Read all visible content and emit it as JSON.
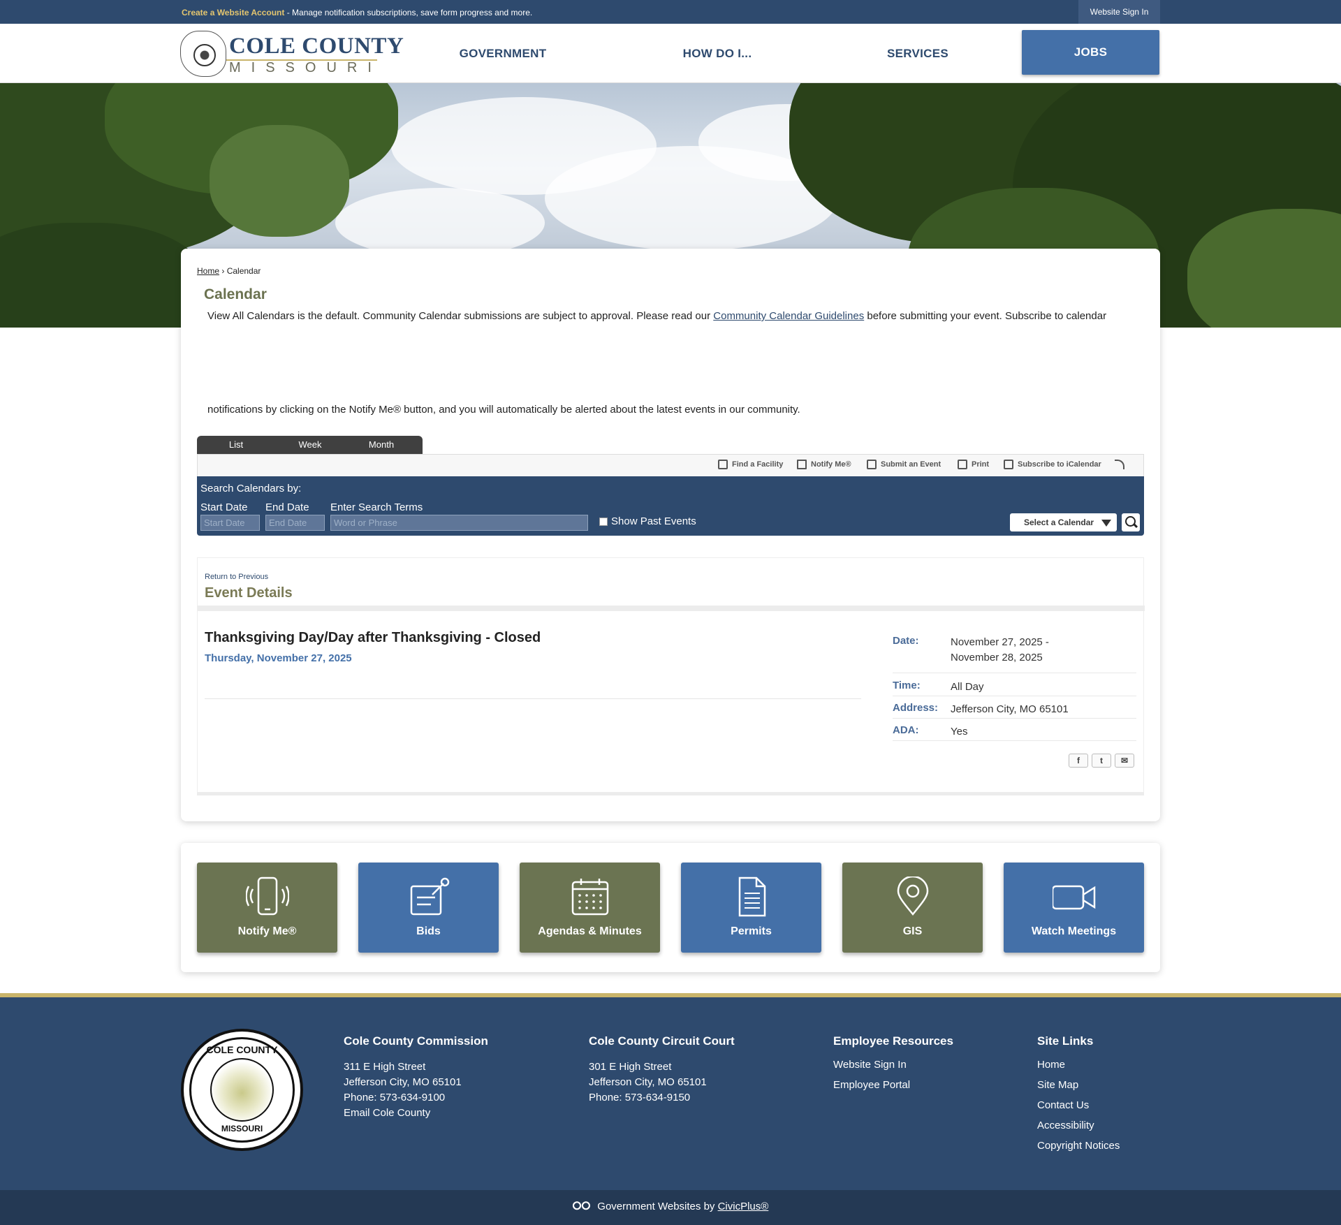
{
  "topbar": {
    "create_account": "Create a Website Account",
    "message": " - Manage notification subscriptions, save form progress and more.",
    "sign_in": "Website Sign In"
  },
  "logo": {
    "line1": "COLE COUNTY",
    "line2": "MISSOURI"
  },
  "nav": [
    "GOVERNMENT",
    "HOW DO I...",
    "SERVICES",
    "JOBS"
  ],
  "breadcrumb": {
    "home": "Home",
    "sep": "›",
    "current": "Calendar"
  },
  "page": {
    "title": "Calendar",
    "intro_before": "View All Calendars is the default. Community Calendar submissions are subject to approval. Please read our ",
    "intro_link": "Community Calendar Guidelines",
    "intro_after": " before submitting your event. Subscribe to calendar",
    "intro_line2": "notifications by clicking on the Notify Me® button, and you will automatically be alerted about the latest events in our community."
  },
  "view_tabs": [
    "List",
    "Week",
    "Month"
  ],
  "tools": [
    "Find a Facility",
    "Notify Me®",
    "Submit an Event",
    "Print",
    "Subscribe to iCalendar"
  ],
  "search": {
    "title": "Search Calendars by:",
    "start_label": "Start Date",
    "end_label": "End Date",
    "terms_label": "Enter Search Terms",
    "start_placeholder": "Start Date",
    "end_placeholder": "End Date",
    "terms_placeholder": "Word or Phrase",
    "past_events": "Show Past Events",
    "calendar_select": "Select a Calendar"
  },
  "event": {
    "return": "Return to Previous",
    "section_title": "Event Details",
    "name": "Thanksgiving Day/Day after Thanksgiving - Closed",
    "date_line": "Thursday, November 27, 2025",
    "details": [
      {
        "key": "Date:",
        "value": "November 27, 2025 -",
        "value2": "November 28, 2025"
      },
      {
        "key": "Time:",
        "value": "All Day"
      },
      {
        "key": "Address:",
        "value": "Jefferson City, MO 65101"
      },
      {
        "key": "ADA:",
        "value": "Yes"
      }
    ]
  },
  "quick_links": [
    "Notify Me®",
    "Bids",
    "Agendas & Minutes",
    "Permits",
    "GIS",
    "Watch Meetings"
  ],
  "footer": {
    "seal_top": "COLE COUNTY",
    "seal_bottom": "MISSOURI",
    "commission": {
      "title": "Cole County Commission",
      "lines": [
        "311 E High Street",
        "Jefferson City, MO 65101",
        "Phone: 573-634-9100",
        "Email Cole County"
      ]
    },
    "court": {
      "title": "Cole County Circuit Court",
      "lines": [
        "301 E High Street",
        "Jefferson City, MO 65101",
        "Phone: 573-634-9150"
      ]
    },
    "employee": {
      "title": "Employee Resources",
      "links": [
        "Website Sign In",
        "Employee Portal"
      ]
    },
    "site": {
      "title": "Site Links",
      "links": [
        "Home",
        "Site Map",
        "Contact Us",
        "Accessibility",
        "Copyright Notices"
      ]
    },
    "credit_prefix": "Government Websites by ",
    "credit_link": "CivicPlus®"
  },
  "colors": {
    "navy": "#2e4a6e",
    "accent_blue": "#4470a8",
    "olive": "#6b7452",
    "gold": "#c9b46a"
  }
}
